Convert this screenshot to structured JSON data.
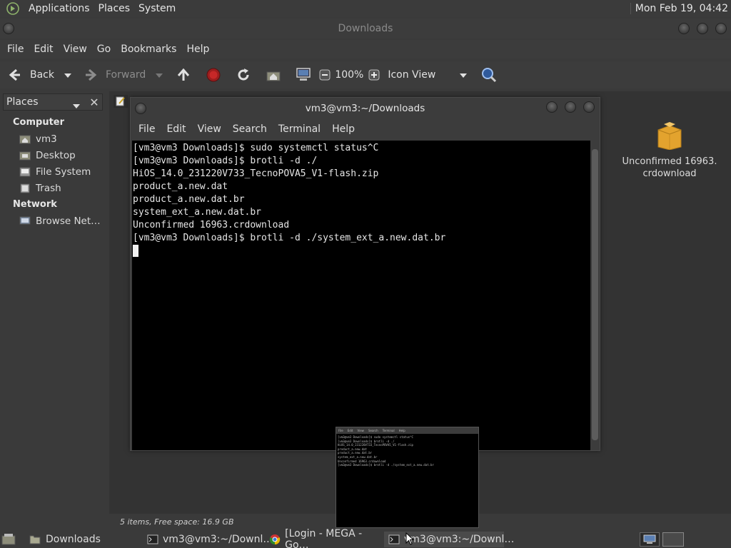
{
  "top_panel": {
    "menus": [
      "Applications",
      "Places",
      "System"
    ],
    "clock": "Mon Feb 19, 04:42"
  },
  "file_manager": {
    "title": "Downloads",
    "menu": [
      "File",
      "Edit",
      "View",
      "Go",
      "Bookmarks",
      "Help"
    ],
    "toolbar": {
      "back": "Back",
      "forward": "Forward",
      "zoom": "100%",
      "view_mode": "Icon View"
    },
    "places": {
      "header": "Places",
      "computer_label": "Computer",
      "computer_items": [
        "vm3",
        "Desktop",
        "File System",
        "Trash"
      ],
      "network_label": "Network",
      "network_items": [
        "Browse Net…"
      ]
    },
    "file": {
      "line1": "Unconfirmed 16963.",
      "line2": "crdownload"
    },
    "status": "5 items, Free space: 16.9 GB"
  },
  "terminal": {
    "title": "vm3@vm3:~/Downloads",
    "menu": [
      "File",
      "Edit",
      "View",
      "Search",
      "Terminal",
      "Help"
    ],
    "lines": [
      "[vm3@vm3 Downloads]$ sudo systemctl status^C",
      "[vm3@vm3 Downloads]$ brotli -d ./",
      "HiOS_14.0_231220V733_TecnoPOVA5_V1-flash.zip",
      "product_a.new.dat",
      "product_a.new.dat.br",
      "system_ext_a.new.dat.br",
      "Unconfirmed 16963.crdownload",
      "[vm3@vm3 Downloads]$ brotli -d ./system_ext_a.new.dat.br"
    ]
  },
  "taskbar": {
    "tasks": [
      "Downloads",
      "vm3@vm3:~/Downl…",
      "[Login - MEGA - Go…",
      "vm3@vm3:~/Downl…"
    ]
  },
  "colors": {
    "terminal_bg": "#000000",
    "panel_bg": "#3b3b3b",
    "text": "#dcdcdc"
  }
}
